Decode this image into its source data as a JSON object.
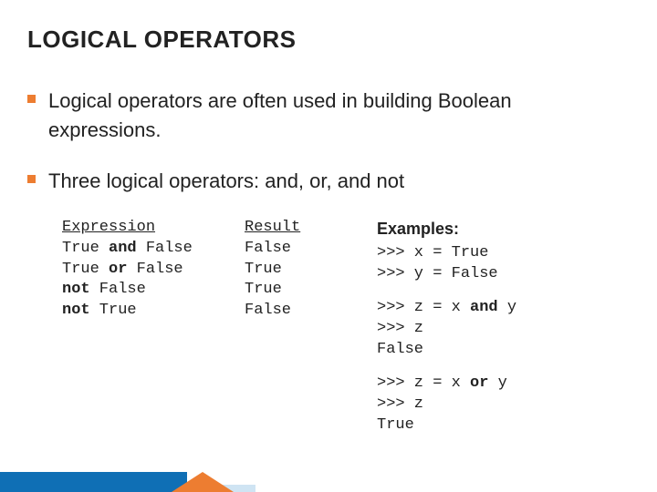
{
  "title": "LOGICAL OPERATORS",
  "bullets": {
    "b1": "Logical operators are often used in building Boolean expressions.",
    "b2": "Three logical operators: and, or, and not"
  },
  "table": {
    "header1": "Expression",
    "header2": "Result",
    "r1e": "True ",
    "r1op": "and",
    "r1e2": " False",
    "r1r": "False",
    "r2e": "True ",
    "r2op": "or",
    "r2e2": " False",
    "r2r": "True",
    "r3op": "not",
    "r3e2": " False",
    "r3r": "True",
    "r4op": "not",
    "r4e2": " True",
    "r4r": "False"
  },
  "examples": {
    "label": "Examples:",
    "block1": ">>> x = True\n>>> y = False",
    "block2a": ">>> z = x ",
    "block2op": "and",
    "block2b": " y\n>>> z\nFalse",
    "block3a": ">>> z = x ",
    "block3op": "or",
    "block3b": " y\n>>> z\nTrue"
  }
}
